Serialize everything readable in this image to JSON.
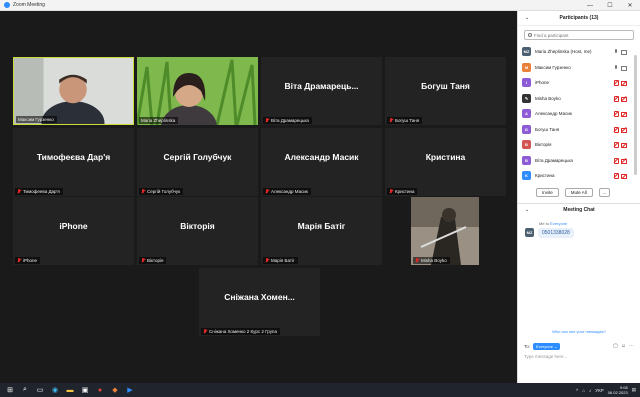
{
  "window": {
    "title": "Zoom Meeting",
    "minimize": "—",
    "maximize": "☐",
    "close": "✕"
  },
  "tiles": [
    {
      "name": "Максим Гурзенко",
      "big": "",
      "kind": "cam-man",
      "mic": false,
      "active": true
    },
    {
      "name": "Maria Zheplinska",
      "big": "",
      "kind": "cam-woman",
      "mic": false,
      "active": false
    },
    {
      "name": "Віта Драмарецька",
      "big": "Віта Драмарець...",
      "kind": "name",
      "mic": true
    },
    {
      "name": "Богуш Таня",
      "big": "Богуш Таня",
      "kind": "name",
      "mic": true
    },
    {
      "name": "Тимофеева Дар'я",
      "big": "Тимофеєва Дар'я",
      "kind": "name",
      "mic": true
    },
    {
      "name": "Сергій Голубчук",
      "big": "Сергій Голубчук",
      "kind": "name",
      "mic": true
    },
    {
      "name": "Александр Масик",
      "big": "Александр Масик",
      "kind": "name",
      "mic": true
    },
    {
      "name": "Кристина",
      "big": "Кристина",
      "kind": "name",
      "mic": true
    },
    {
      "name": "iPhone",
      "big": "iPhone",
      "kind": "name",
      "mic": true
    },
    {
      "name": "Вікторія",
      "big": "Вікторія",
      "kind": "name",
      "mic": true
    },
    {
      "name": "Марія Батіг",
      "big": "Марія Батіг",
      "kind": "name",
      "mic": true
    },
    {
      "name": "Misha Boyko",
      "big": "",
      "kind": "photo",
      "mic": true
    },
    {
      "name": "Сніжана Хоменко 2 Курс 2 Група",
      "big": "Сніжана Хомен...",
      "kind": "name",
      "mic": true
    }
  ],
  "participants": {
    "title": "Participants (13)",
    "search_placeholder": "Find a participant",
    "items": [
      {
        "initials": "MZ",
        "color": "#4b5f70",
        "label": "Maria Zheplinska (Host, me)",
        "mic": "gray",
        "cam": "gray"
      },
      {
        "initials": "M",
        "color": "#e8813a",
        "label": "Максим Гурзенко",
        "mic": "gray",
        "cam": "gray"
      },
      {
        "initials": "I",
        "color": "#8e5bd6",
        "label": "iPhone",
        "mic": "red",
        "cam": "red"
      },
      {
        "initials": "✎",
        "color": "#333333",
        "label": "Misha Boyko",
        "mic": "red",
        "cam": "red"
      },
      {
        "initials": "A",
        "color": "#8e5bd6",
        "label": "Александр Масик",
        "mic": "red",
        "cam": "red"
      },
      {
        "initials": "Б",
        "color": "#8e5bd6",
        "label": "Богуш Таня",
        "mic": "red",
        "cam": "red"
      },
      {
        "initials": "B",
        "color": "#d35454",
        "label": "Вікторія",
        "mic": "red",
        "cam": "red"
      },
      {
        "initials": "B",
        "color": "#8e5bd6",
        "label": "Віта Драмарецька",
        "mic": "red",
        "cam": "red"
      },
      {
        "initials": "K",
        "color": "#2d8cff",
        "label": "Кристина",
        "mic": "red",
        "cam": "red"
      }
    ],
    "invite": "Invite",
    "mute_all": "Mute All",
    "more": "..."
  },
  "chat": {
    "title": "Meeting Chat",
    "from": "Me to ",
    "to": "Everyone",
    "avatar": "MZ",
    "message": "0501338028",
    "who_can_see": "Who can see your messages?",
    "to_label": "To:",
    "to_value": "Everyone ⌄",
    "placeholder": "Type message here..."
  },
  "taskbar": {
    "lang": "УКР",
    "time": "9:08",
    "date": "06.02.2023"
  }
}
